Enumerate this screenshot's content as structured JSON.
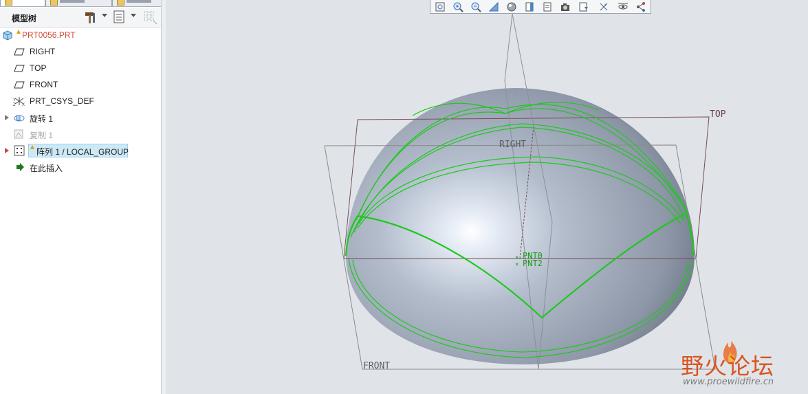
{
  "model_tree": {
    "title": "模型树",
    "items": [
      {
        "label": "PRT0056.PRT",
        "icon": "part-icon",
        "color": "#d4503c",
        "warning": true
      },
      {
        "label": "RIGHT",
        "icon": "datum-plane-icon"
      },
      {
        "label": "TOP",
        "icon": "datum-plane-icon"
      },
      {
        "label": "FRONT",
        "icon": "datum-plane-icon"
      },
      {
        "label": "PRT_CSYS_DEF",
        "icon": "coordinate-system-icon"
      },
      {
        "label": "旋转 1",
        "icon": "revolve-icon",
        "expandable": true
      },
      {
        "label": "复制 1",
        "icon": "copy-icon",
        "disabled": true
      },
      {
        "label": "阵列 1 / LOCAL_GROUP",
        "icon": "pattern-icon",
        "expandable": true,
        "selected": true,
        "warning": true
      },
      {
        "label": "在此插入",
        "icon": "insert-here-arrow-icon"
      }
    ]
  },
  "viewport": {
    "datum_labels": {
      "top": "TOP",
      "right": "RIGHT",
      "front": "FRONT"
    },
    "point_labels": [
      "PNT0",
      "PNT2"
    ],
    "toolbar_icons": [
      "refit-icon",
      "zoom-in-icon",
      "zoom-out-icon",
      "repaint-icon",
      "display-style-icon",
      "saved-orientations-icon",
      "view-manager-icon",
      "perspective-icon",
      "annotation-display-icon",
      "datum-display-icon",
      "spin-center-icon",
      "plane-display-icon"
    ],
    "colors": {
      "curve": "#1ec81e",
      "datum": "#7a4a55",
      "surface": "#9aa6b8"
    }
  },
  "watermark": {
    "text": "野火论坛",
    "url": "www.proewildfire.cn"
  }
}
